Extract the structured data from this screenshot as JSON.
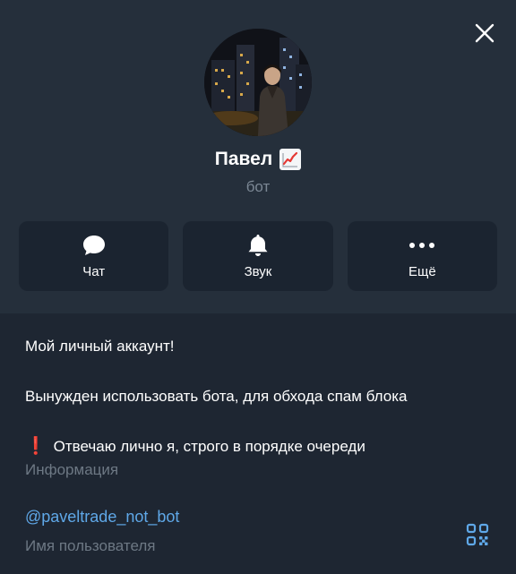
{
  "profile": {
    "name": "Павел",
    "name_emoji": "chart-increasing-emoji",
    "status": "бот"
  },
  "actions": [
    {
      "label": "Чат",
      "icon": "chat-bubble-icon"
    },
    {
      "label": "Звук",
      "icon": "bell-icon"
    },
    {
      "label": "Ещё",
      "icon": "more-dots-icon"
    }
  ],
  "info": {
    "bio_line1": "Мой личный аккаунт!",
    "bio_line2": "Вынужден использовать бота, для обхода спам блока",
    "bio_line3": "Отвечаю лично я, строго в порядке очереди",
    "bio_line3_emoji": "❗",
    "caption": "Информация"
  },
  "username": {
    "value": "@paveltrade_not_bot",
    "caption": "Имя пользователя"
  },
  "colors": {
    "header_bg": "#252f3b",
    "body_bg": "#1e2632",
    "button_bg": "#1b2430",
    "link": "#5fa8e8",
    "muted": "#6d7884"
  }
}
